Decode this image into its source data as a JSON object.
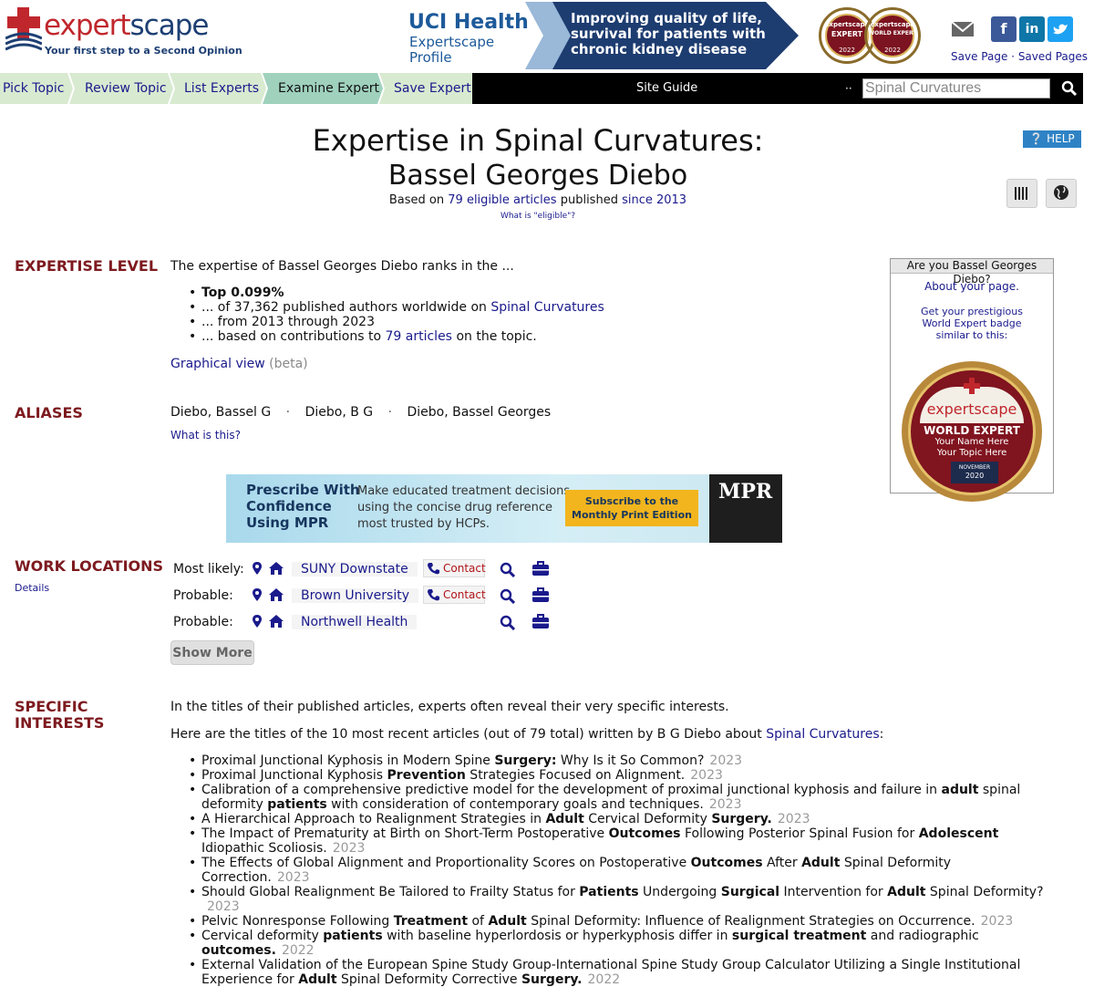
{
  "header": {
    "logo_a": "expert",
    "logo_b": "scape",
    "tagline": "Your first step to a Second Opinion",
    "ad": {
      "title": "UCI Health",
      "subtitle_1": "Expertscape",
      "subtitle_2": "Profile",
      "message": "Improving quality of life, survival for patients with chronic kidney disease",
      "badge1_top": "expertscape",
      "badge1_label": "EXPERT",
      "badge1_year": "2022",
      "badge2_top": "expertscape",
      "badge2_label": "WORLD EXPERT",
      "badge2_year": "2022"
    },
    "save_page": "Save Page",
    "saved_pages": "Saved Pages",
    "separator": "·",
    "icons": [
      "envelope-icon",
      "facebook-icon",
      "linkedin-icon",
      "twitter-icon"
    ]
  },
  "nav": {
    "steps": [
      "Pick Topic",
      "Review Topic",
      "List Experts",
      "Examine Expert",
      "Save Expert"
    ],
    "active_step": "Examine Expert",
    "site_guide": "Site Guide",
    "dots": "··",
    "search_value": "Spinal Curvatures"
  },
  "title": {
    "line1": "Expertise in Spinal Curvatures:",
    "line2": "Bassel Georges Diebo",
    "based_pre": "Based on",
    "based_link": "79 eligible articles",
    "based_mid": "published",
    "based_since": "since 2013",
    "eligible_q": "What is \"eligible\"?",
    "help": "HELP"
  },
  "expertise": {
    "label": "EXPERTISE LEVEL",
    "intro": "The expertise of Bassel Georges Diebo ranks in the ...",
    "rank": "Top 0.099%",
    "line2_pre": "... of 37,362 published authors worldwide on",
    "line2_link": "Spinal Curvatures",
    "line3": "... from 2013 through 2023",
    "line4_pre": "... based on contributions to",
    "line4_link": "79 articles",
    "line4_post": "on the topic.",
    "graphical": "Graphical view",
    "beta": "(beta)"
  },
  "aliases": {
    "label": "ALIASES",
    "list": [
      "Diebo, Bassel G",
      "Diebo, B G",
      "Diebo, Bassel Georges"
    ],
    "sep": "·",
    "what": "What is this?"
  },
  "sidebar": {
    "head": "Are you Bassel Georges Diebo?",
    "about": "About your page.",
    "get_1": "Get your prestigious",
    "get_2": "World Expert badge",
    "get_3": "similar to this:",
    "badge_brand": "expertscape",
    "badge_title": "WORLD EXPERT",
    "badge_name": "Your Name Here",
    "badge_topic": "Your Topic Here",
    "badge_month": "NOVEMBER",
    "badge_year": "2020"
  },
  "ad_mid": {
    "headline_1": "Prescribe With",
    "headline_2": "Confidence",
    "headline_3": "Using MPR",
    "body_1": "Make educated treatment decisions",
    "body_2": "using the concise drug reference",
    "body_3": "most trusted by HCPs.",
    "button_1": "Subscribe to the",
    "button_2": "Monthly Print Edition",
    "mag": "MPR"
  },
  "locations": {
    "label": "WORK LOCATIONS",
    "details": "Details",
    "rows": [
      {
        "label": "Most likely:",
        "name": "SUNY Downstate",
        "contact": "Contact"
      },
      {
        "label": "Probable:",
        "name": "Brown University",
        "contact": "Contact"
      },
      {
        "label": "Probable:",
        "name": "Northwell Health",
        "contact": ""
      }
    ],
    "show_more": "Show More"
  },
  "interests": {
    "label_1": "SPECIFIC",
    "label_2": "INTERESTS",
    "intro": "In the titles of their published articles, experts often reveal their very specific interests.",
    "lead_pre": "Here are the titles of the 10 most recent articles (out of 79 total) written by B G Diebo about",
    "lead_link": "Spinal Curvatures",
    "lead_post": ":",
    "articles": [
      {
        "parts": [
          [
            "Proximal Junctional Kyphosis in Modern Spine ",
            false
          ],
          [
            "Surgery:",
            true
          ],
          [
            " Why Is it So Common?",
            false
          ]
        ],
        "year": "2023"
      },
      {
        "parts": [
          [
            "Proximal Junctional Kyphosis ",
            false
          ],
          [
            "Prevention",
            true
          ],
          [
            " Strategies Focused on Alignment.",
            false
          ]
        ],
        "year": "2023"
      },
      {
        "parts": [
          [
            "Calibration of a comprehensive predictive model for the development of proximal junctional kyphosis and failure in ",
            false
          ],
          [
            "adult",
            true
          ],
          [
            " spinal deformity ",
            false
          ],
          [
            "patients",
            true
          ],
          [
            " with consideration of contemporary goals and techniques.",
            false
          ]
        ],
        "year": "2023"
      },
      {
        "parts": [
          [
            "A Hierarchical Approach to Realignment Strategies in ",
            false
          ],
          [
            "Adult",
            true
          ],
          [
            " Cervical Deformity ",
            false
          ],
          [
            "Surgery.",
            true
          ]
        ],
        "year": "2023"
      },
      {
        "parts": [
          [
            "The Impact of Prematurity at Birth on Short-Term Postoperative ",
            false
          ],
          [
            "Outcomes",
            true
          ],
          [
            " Following Posterior Spinal Fusion for ",
            false
          ],
          [
            "Adolescent",
            true
          ],
          [
            " Idiopathic Scoliosis.",
            false
          ]
        ],
        "year": "2023"
      },
      {
        "parts": [
          [
            "The Effects of Global Alignment and Proportionality Scores on Postoperative ",
            false
          ],
          [
            "Outcomes",
            true
          ],
          [
            " After ",
            false
          ],
          [
            "Adult",
            true
          ],
          [
            " Spinal Deformity Correction.",
            false
          ]
        ],
        "year": "2023"
      },
      {
        "parts": [
          [
            "Should Global Realignment Be Tailored to Frailty Status for ",
            false
          ],
          [
            "Patients",
            true
          ],
          [
            " Undergoing ",
            false
          ],
          [
            "Surgical",
            true
          ],
          [
            " Intervention for ",
            false
          ],
          [
            "Adult",
            true
          ],
          [
            " Spinal Deformity?",
            false
          ]
        ],
        "year": "2023"
      },
      {
        "parts": [
          [
            "Pelvic Nonresponse Following ",
            false
          ],
          [
            "Treatment",
            true
          ],
          [
            " of ",
            false
          ],
          [
            "Adult",
            true
          ],
          [
            " Spinal Deformity: Influence of Realignment Strategies on Occurrence.",
            false
          ]
        ],
        "year": "2023"
      },
      {
        "parts": [
          [
            "Cervical deformity ",
            false
          ],
          [
            "patients",
            true
          ],
          [
            " with baseline hyperlordosis or hyperkyphosis differ in ",
            false
          ],
          [
            "surgical treatment",
            true
          ],
          [
            " and radiographic ",
            false
          ],
          [
            "outcomes.",
            true
          ]
        ],
        "year": "2022"
      },
      {
        "parts": [
          [
            "External Validation of the European Spine Study Group-International Spine Study Group Calculator Utilizing a Single Institutional Experience for ",
            false
          ],
          [
            "Adult",
            true
          ],
          [
            " Spinal Deformity Corrective ",
            false
          ],
          [
            "Surgery.",
            true
          ]
        ],
        "year": "2022"
      }
    ]
  },
  "colors": {
    "brand_red": "#c0272d",
    "brand_navy": "#1d3f73",
    "section_label": "#7d1a1f",
    "nav_active": "#9fd1bd",
    "nav_inactive": "#d8ead0",
    "help_blue": "#2f83c5"
  }
}
